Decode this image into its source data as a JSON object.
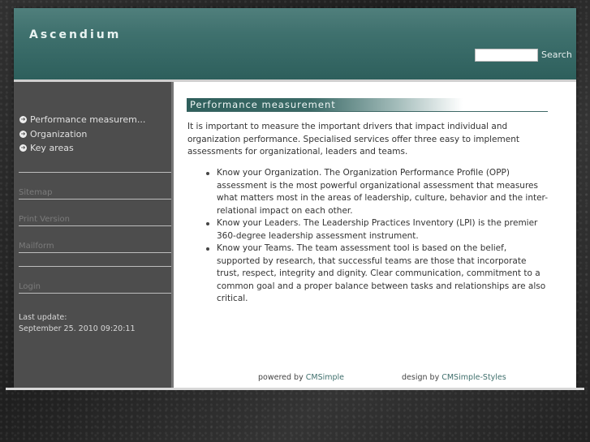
{
  "header": {
    "site_title": "Ascendium",
    "search_placeholder": "",
    "search_button": "Search"
  },
  "sidebar": {
    "nav_items": [
      {
        "label": "Performance measurem...",
        "icon": "arrow-circle-icon"
      },
      {
        "label": "Organization",
        "icon": "arrow-circle-icon"
      },
      {
        "label": "Key areas",
        "icon": "arrow-circle-icon"
      }
    ],
    "links": {
      "sitemap": "Sitemap",
      "print_version": "Print Version",
      "mailform": "Mailform",
      "login": "Login"
    },
    "last_update_label": "Last update:",
    "last_update_value": "September 25. 2010 09:20:11"
  },
  "content": {
    "heading": "Performance measurement",
    "intro": "It is important to measure the important drivers that impact individual and organization performance. Specialised services offer three easy to implement assessments for organizational, leaders and teams.",
    "bullets": [
      "Know your Organization. The Organization Performance Profile (OPP) assessment is the most powerful organizational assessment that measures what matters most in the areas of leadership, culture, behavior and the inter-relational impact on each other.",
      "Know your Leaders. The Leadership Practices Inventory (LPI) is the premier 360-degree leadership assessment instrument.",
      "Know your Teams. The team assessment tool is based on the belief, supported by research, that successful teams are those that incorporate trust, respect, integrity and dignity. Clear communication, commitment to a common goal and a proper balance between tasks and relationships are also critical."
    ]
  },
  "footer": {
    "powered_prefix": "powered by ",
    "powered_link": "CMSimple",
    "design_prefix": "design by ",
    "design_link": "CMSimple-Styles"
  },
  "colors": {
    "header_teal": "#3f716e",
    "sidebar_gray": "#4d4d4d",
    "link_teal": "#3f6f6c"
  }
}
